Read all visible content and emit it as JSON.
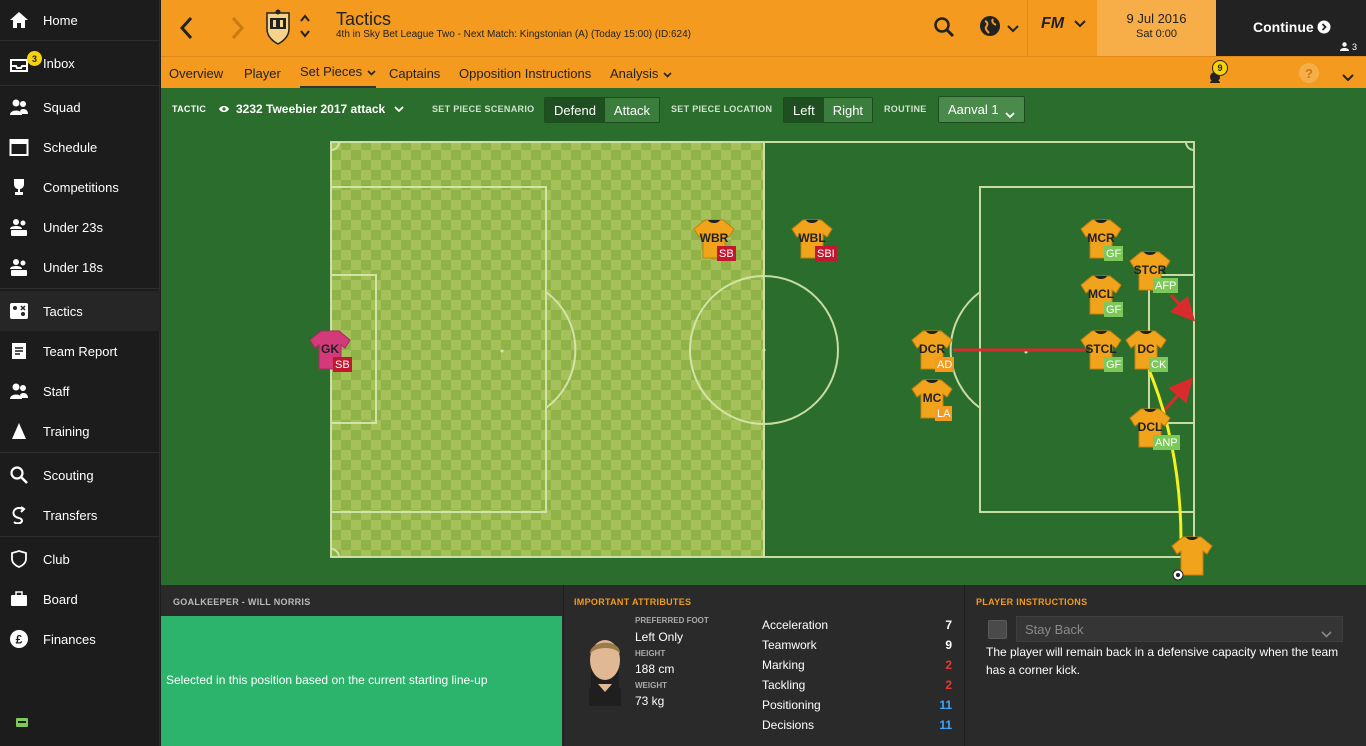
{
  "sidebar": {
    "items": [
      {
        "label": "Home",
        "icon": "home-icon"
      },
      {
        "label": "Inbox",
        "icon": "inbox-icon",
        "badge": "3"
      },
      {
        "label": "Squad",
        "icon": "squad-icon"
      },
      {
        "label": "Schedule",
        "icon": "schedule-icon"
      },
      {
        "label": "Competitions",
        "icon": "trophy-icon"
      },
      {
        "label": "Under 23s",
        "icon": "u23-icon"
      },
      {
        "label": "Under 18s",
        "icon": "u18-icon"
      },
      {
        "label": "Tactics",
        "icon": "tactics-icon"
      },
      {
        "label": "Team Report",
        "icon": "report-icon"
      },
      {
        "label": "Staff",
        "icon": "staff-icon"
      },
      {
        "label": "Training",
        "icon": "training-icon"
      },
      {
        "label": "Scouting",
        "icon": "search-icon"
      },
      {
        "label": "Transfers",
        "icon": "transfers-icon"
      },
      {
        "label": "Club",
        "icon": "club-icon"
      },
      {
        "label": "Board",
        "icon": "board-icon"
      },
      {
        "label": "Finances",
        "icon": "finances-icon"
      }
    ]
  },
  "header": {
    "title": "Tactics",
    "subtitle": "4th in Sky Bet League Two - Next Match: Kingstonian (A) (Today 15:00) (ID:624)",
    "date": "9 Jul 2016",
    "time": "Sat 0:00",
    "continue_label": "Continue",
    "users_count": "3",
    "fm_label": "FM"
  },
  "subnav": {
    "tabs": [
      "Overview",
      "Player",
      "Set Pieces",
      "Captains",
      "Opposition Instructions",
      "Analysis"
    ],
    "notification_count": "9",
    "help_label": "?"
  },
  "toolbar": {
    "tactic_label": "TACTIC",
    "tactic_value": "3232 Tweebier 2017 attack",
    "scenario_label": "SET PIECE SCENARIO",
    "scenario_options": [
      "Defend",
      "Attack"
    ],
    "location_label": "SET PIECE LOCATION",
    "location_options": [
      "Left",
      "Right"
    ],
    "routine_label": "ROUTINE",
    "routine_value": "Aanval 1"
  },
  "pitch": {
    "players": [
      {
        "pos": "GK",
        "role": "SB"
      },
      {
        "pos": "WBR",
        "role": "SB"
      },
      {
        "pos": "WBL",
        "role": "SBI"
      },
      {
        "pos": "MCR",
        "role": "GF"
      },
      {
        "pos": "STCR",
        "role": "AFP"
      },
      {
        "pos": "MCL",
        "role": "GF"
      },
      {
        "pos": "DCR",
        "role": "AD"
      },
      {
        "pos": "STCL",
        "role": "GF"
      },
      {
        "pos": "DC",
        "role": "CK"
      },
      {
        "pos": "MC",
        "role": "LA"
      },
      {
        "pos": "DCL",
        "role": "ANP"
      }
    ]
  },
  "bottom": {
    "left_title": "GOALKEEPER - WILL NORRIS",
    "left_text": "Selected in this position based on the current starting line-up",
    "attr_title": "IMPORTANT ATTRIBUTES",
    "foot_label": "PREFERRED FOOT",
    "foot_value": "Left Only",
    "height_label": "HEIGHT",
    "height_value": "188 cm",
    "weight_label": "WEIGHT",
    "weight_value": "73 kg",
    "attributes": [
      {
        "name": "Acceleration",
        "value": "7",
        "color": "#ffffff"
      },
      {
        "name": "Teamwork",
        "value": "9",
        "color": "#ffffff"
      },
      {
        "name": "Marking",
        "value": "2",
        "color": "#e53935"
      },
      {
        "name": "Tackling",
        "value": "2",
        "color": "#e53935"
      },
      {
        "name": "Positioning",
        "value": "11",
        "color": "#42a5f5"
      },
      {
        "name": "Decisions",
        "value": "11",
        "color": "#42a5f5"
      }
    ],
    "instr_title": "PLAYER INSTRUCTIONS",
    "instr_option": "Stay Back",
    "instr_text": "The player will remain back in a defensive capacity when the team has a corner kick."
  },
  "colors": {
    "accent": "#f39a1f",
    "pitch": "#2b6d2c",
    "green_panel": "#2db46c"
  }
}
